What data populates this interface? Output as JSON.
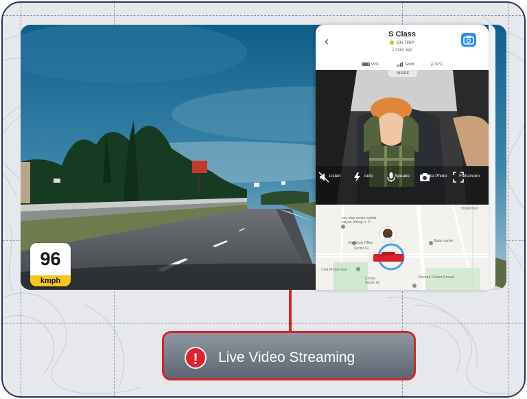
{
  "speedometer": {
    "value": "96",
    "unit": "kmph"
  },
  "vehicle": {
    "name": "S Class",
    "status": "ON TRIP",
    "updated": "2 mins ago"
  },
  "stats": {
    "battery": "99%",
    "signal": "Good",
    "temperature": "32°C"
  },
  "camera_view": {
    "tag": "INSIDE"
  },
  "controls": [
    {
      "label": "Listen",
      "icon": "mute-speaker-icon"
    },
    {
      "label": "Auto",
      "icon": "auto-flash-icon"
    },
    {
      "label": "Speake",
      "icon": "microphone-icon"
    },
    {
      "label": "Take Photo",
      "icon": "camera-icon"
    },
    {
      "label": "Fullscreen",
      "icon": "fullscreen-icon"
    }
  ],
  "map": {
    "labels": [
      "Shakti Kun",
      "one stop centre mahila",
      "kalyan vibhag U. P",
      "Electricity Office",
      "Sector 61",
      "Baba market",
      "Chat Phobo shat",
      "S Park",
      "Sector 62",
      "Noveda Cricket Ground"
    ]
  },
  "callout": {
    "text": "Live Video Streaming",
    "icon": "alert-icon"
  },
  "colors": {
    "accent_red": "#d8232a",
    "badge_yellow": "#f6c619",
    "app_blue": "#2e8de6",
    "frame_navy": "#2b2f6b"
  }
}
